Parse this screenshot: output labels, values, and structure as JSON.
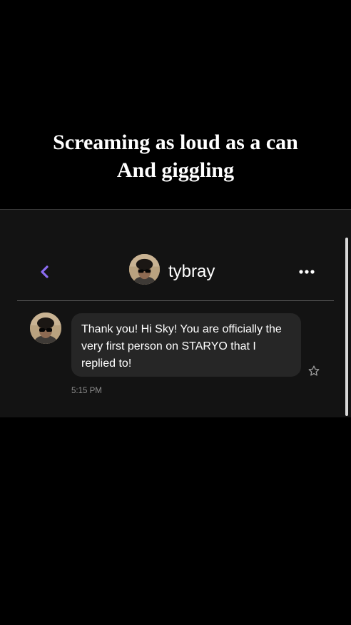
{
  "caption": {
    "line1": "Screaming as loud as a can",
    "line2": "And giggling"
  },
  "chat": {
    "username": "tybray",
    "message_lines": [
      "Thank you! Hi Sky! You are officially the",
      "very first person on STARYO that I",
      "replied to!"
    ],
    "timestamp": "5:15 PM"
  },
  "icons": {
    "back": "chevron-left-icon",
    "more": "more-horizontal-icon",
    "star": "star-outline-icon"
  },
  "colors": {
    "accent": "#8b6cf0",
    "background": "#000000",
    "panel": "#131313",
    "bubble": "#262626",
    "muted_text": "#8e8e8e"
  }
}
